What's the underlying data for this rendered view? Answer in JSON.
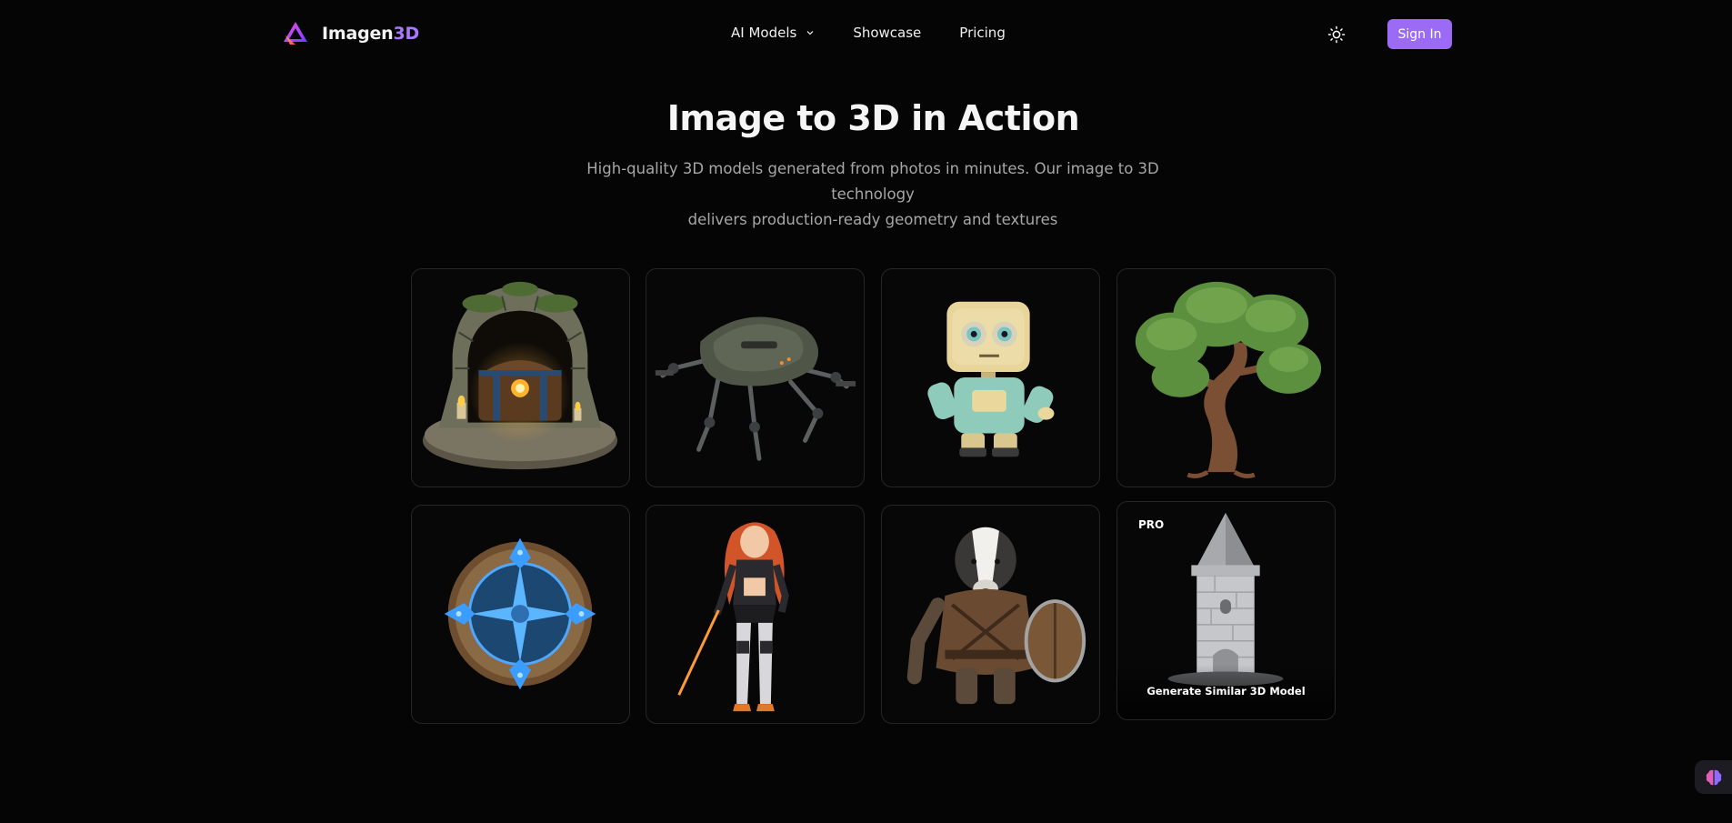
{
  "header": {
    "brand_name": "Imagen",
    "brand_accent": "3D",
    "nav": [
      {
        "label": "AI Models",
        "has_dropdown": true
      },
      {
        "label": "Showcase"
      },
      {
        "label": "Pricing"
      }
    ],
    "theme_icon": "sun-icon",
    "signin_label": "Sign In"
  },
  "hero": {
    "title": "Image to 3D in Action",
    "subtitle_line1": "High-quality 3D models generated from photos in minutes. Our image to 3D technology",
    "subtitle_line2": "delivers production-ready geometry and textures"
  },
  "gallery": {
    "items": [
      {
        "subject": "treasure-chest-stone-arch"
      },
      {
        "subject": "mech-spider-robot"
      },
      {
        "subject": "cute-toy-robot"
      },
      {
        "subject": "stylized-tree"
      },
      {
        "subject": "magic-compass-emblem"
      },
      {
        "subject": "anime-warrior-girl"
      },
      {
        "subject": "armored-badger"
      },
      {
        "subject": "stone-tower",
        "badge": "PRO",
        "action_label": "Generate Similar 3D Model"
      }
    ]
  },
  "colors": {
    "background": "#050505",
    "accent": "#9b6bf5",
    "brand_accent": "#a879ff",
    "card_border": "#262626",
    "muted_text": "#a7a7a7"
  },
  "floating_button_icon": "brain-icon"
}
